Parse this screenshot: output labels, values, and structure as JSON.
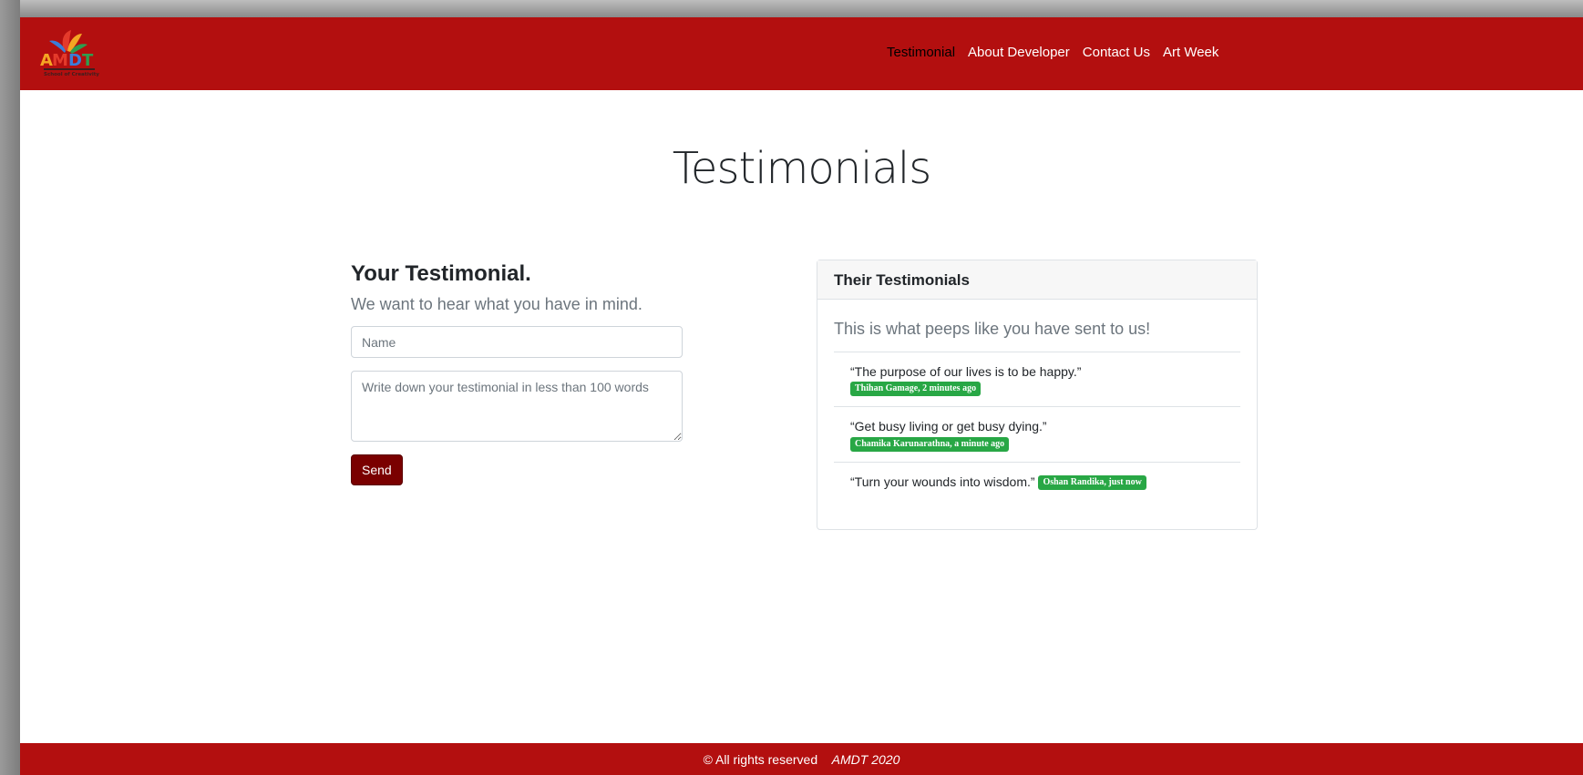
{
  "nav": {
    "logo_text": "AMDT",
    "logo_tagline": "School of Creativity",
    "links": [
      "Testimonial",
      "About Developer",
      "Contact Us",
      "Art Week"
    ]
  },
  "page_title": "Testimonials",
  "form": {
    "title": "Your Testimonial.",
    "subtitle": "We want to hear what you have in mind.",
    "name_placeholder": "Name",
    "testimonial_placeholder": "Write down your testimonial in less than 100 words",
    "send_label": "Send"
  },
  "testimonials_card": {
    "header": "Their Testimonials",
    "lead": "This is what peeps like you have sent to us!",
    "items": [
      {
        "quote": "“The purpose of our lives is to be happy.”",
        "badge": "Thihan Gamage, 2 minutes ago"
      },
      {
        "quote": "“Get busy living or get busy dying.”",
        "badge": "Chamika Karunarathna, a minute ago"
      },
      {
        "quote": "“Turn your wounds into wisdom.”",
        "badge": "Oshan Randika, just now"
      }
    ]
  },
  "footer": {
    "text": "© All rights reserved",
    "brand": "AMDT 2020"
  },
  "colors": {
    "brand_red": "#b30f0f",
    "button_dark_red": "#7a0000",
    "badge_green": "#28a745"
  }
}
